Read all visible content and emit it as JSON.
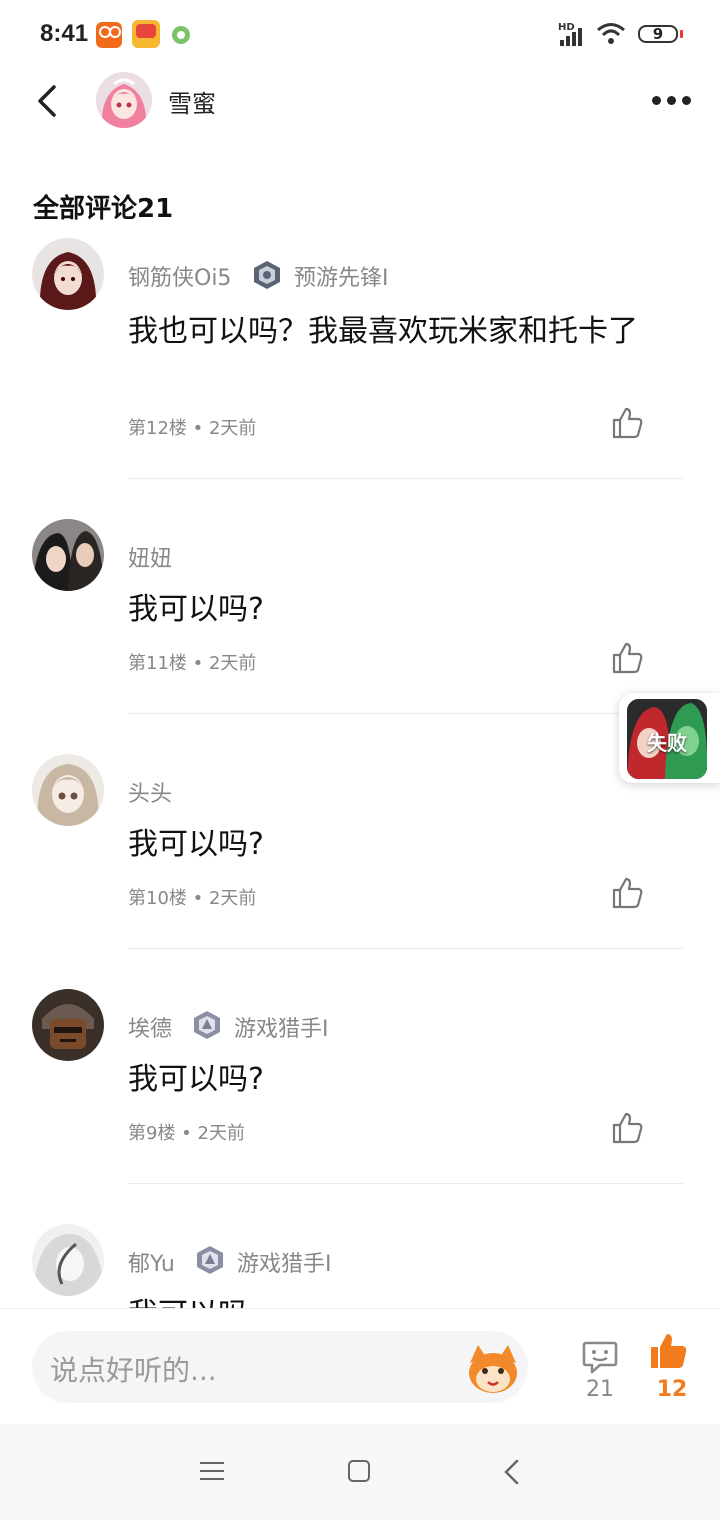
{
  "status_bar": {
    "time": "8:41",
    "signal_label": "HD",
    "battery": "9",
    "icons": [
      "kuaishou-app-icon",
      "game-app-icon",
      "green-app-icon",
      "signal-icon",
      "wifi-icon",
      "battery-icon"
    ]
  },
  "header": {
    "user_name": "雪蜜",
    "icons": [
      "back-arrow-icon",
      "user-avatar",
      "more-icon"
    ]
  },
  "section_title": "全部评论21",
  "comments": [
    {
      "name": "钢筋侠Oi5",
      "badge": "预游先锋I",
      "text": "我也可以吗？我最喜欢玩米家和托卡了",
      "meta": "第12楼 • 2天前"
    },
    {
      "name": "妞妞",
      "badge": "",
      "text": "我可以吗?",
      "meta": "第11楼 • 2天前"
    },
    {
      "name": "头头",
      "badge": "",
      "text": "我可以吗?",
      "meta": "第10楼 • 2天前"
    },
    {
      "name": "埃德",
      "badge": "游戏猎手I",
      "text": "我可以吗?",
      "meta": "第9楼 • 2天前"
    },
    {
      "name": "郁Yu",
      "badge": "游戏猎手I",
      "text": "我可以吗",
      "meta": ""
    }
  ],
  "floating_card": {
    "label": "失败"
  },
  "bottom_bar": {
    "input_placeholder": "说点好听的...",
    "comment_count": "21",
    "like_count": "12"
  },
  "colors": {
    "accent": "#f27c1d",
    "text_primary": "#111111",
    "text_secondary": "#888888",
    "divider": "#ececec",
    "input_bg": "#f5f5f7"
  }
}
